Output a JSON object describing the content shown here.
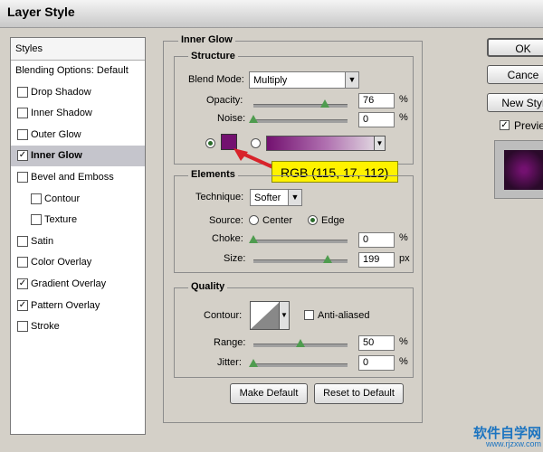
{
  "window": {
    "title": "Layer Style"
  },
  "styles_panel": {
    "header": "Styles",
    "items": [
      {
        "label": "Blending Options: Default",
        "has_checkbox": false,
        "checked": false,
        "selected": false
      },
      {
        "label": "Drop Shadow",
        "has_checkbox": true,
        "checked": false,
        "selected": false
      },
      {
        "label": "Inner Shadow",
        "has_checkbox": true,
        "checked": false,
        "selected": false
      },
      {
        "label": "Outer Glow",
        "has_checkbox": true,
        "checked": false,
        "selected": false
      },
      {
        "label": "Inner Glow",
        "has_checkbox": true,
        "checked": true,
        "selected": true
      },
      {
        "label": "Bevel and Emboss",
        "has_checkbox": true,
        "checked": false,
        "selected": false
      },
      {
        "label": "Contour",
        "has_checkbox": true,
        "checked": false,
        "selected": false
      },
      {
        "label": "Texture",
        "has_checkbox": true,
        "checked": false,
        "selected": false
      },
      {
        "label": "Satin",
        "has_checkbox": true,
        "checked": false,
        "selected": false
      },
      {
        "label": "Color Overlay",
        "has_checkbox": true,
        "checked": false,
        "selected": false
      },
      {
        "label": "Gradient Overlay",
        "has_checkbox": true,
        "checked": true,
        "selected": false
      },
      {
        "label": "Pattern Overlay",
        "has_checkbox": true,
        "checked": true,
        "selected": false
      },
      {
        "label": "Stroke",
        "has_checkbox": true,
        "checked": false,
        "selected": false
      }
    ]
  },
  "inner_glow": {
    "title": "Inner Glow",
    "structure": {
      "title": "Structure",
      "blend_mode_label": "Blend Mode:",
      "blend_mode_value": "Multiply",
      "opacity_label": "Opacity:",
      "opacity_value": "76",
      "opacity_fraction": 0.76,
      "noise_label": "Noise:",
      "noise_value": "0",
      "noise_fraction": 0,
      "percent": "%",
      "glow_color": "#731170"
    },
    "elements": {
      "title": "Elements",
      "technique_label": "Technique:",
      "technique_value": "Softer",
      "source_label": "Source:",
      "source_center": "Center",
      "source_edge": "Edge",
      "choke_label": "Choke:",
      "choke_value": "0",
      "choke_fraction": 0,
      "size_label": "Size:",
      "size_value": "199",
      "size_fraction": 0.79,
      "percent": "%",
      "px": "px"
    },
    "quality": {
      "title": "Quality",
      "contour_label": "Contour:",
      "anti_aliased_label": "Anti-aliased",
      "range_label": "Range:",
      "range_value": "50",
      "range_fraction": 0.5,
      "jitter_label": "Jitter:",
      "jitter_value": "0",
      "jitter_fraction": 0,
      "percent": "%"
    },
    "make_default": "Make Default",
    "reset_default": "Reset to Default"
  },
  "annotation": {
    "text": "RGB (115, 17, 112)",
    "color": "#fff200",
    "arrow_color": "#d8232a"
  },
  "right_buttons": {
    "ok": "OK",
    "cancel": "Cance",
    "new_style": "New Styl",
    "preview": "Previe"
  },
  "watermark": {
    "brand": "软件自学网",
    "url": "www.rjzxw.com"
  }
}
